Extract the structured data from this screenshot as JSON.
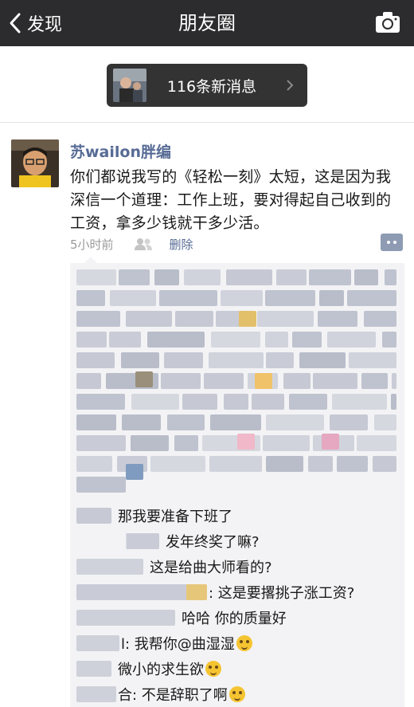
{
  "nav": {
    "back_label": "发现",
    "title": "朋友圈",
    "back_icon": "chevron-left-icon",
    "camera_icon": "camera-icon"
  },
  "notice": {
    "text": "116条新消息"
  },
  "post": {
    "author": "苏wailon胖编",
    "text": "你们都说我写的《轻松一刻》太短，这是因为我深信一个道理：工作上班，要对得起自己收到的工资，拿多少钱就干多少活。",
    "time": "5小时前",
    "delete_label": "删除"
  },
  "comments": [
    {
      "text": "那我要准备下班了"
    },
    {
      "text": "发年终奖了嘛?"
    },
    {
      "text": "这是给曲大师看的?"
    },
    {
      "text": ": 这是要撂挑子涨工资?"
    },
    {
      "text": "哈哈 你的质量好"
    },
    {
      "text": "l: 我帮你@曲湿湿",
      "emoji": true
    },
    {
      "text": "微小的求生欲",
      "emoji": true
    },
    {
      "text": "合: 不是辞职了啊",
      "emoji": true
    }
  ],
  "colors": {
    "navbar": "#2c2c2e",
    "link": "#576b95",
    "comment_bg": "#f3f3f5",
    "blur": "#c9ccd6"
  }
}
